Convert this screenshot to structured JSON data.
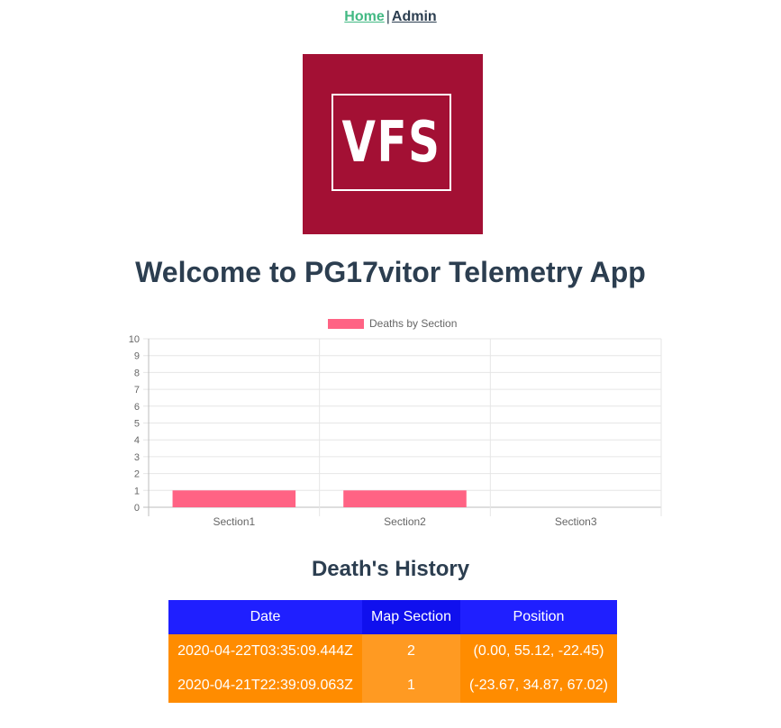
{
  "nav": {
    "home": "Home",
    "separator": "|",
    "admin": "Admin"
  },
  "logo": {
    "text": "VFS",
    "bg_color": "#a31034"
  },
  "title": "Welcome to PG17vitor Telemetry App",
  "chart_data": {
    "type": "bar",
    "categories": [
      "Section1",
      "Section2",
      "Section3"
    ],
    "series": [
      {
        "name": "Deaths by Section",
        "values": [
          1,
          1,
          0
        ],
        "color": "#ff6384"
      }
    ],
    "ylim": [
      0,
      10
    ],
    "yticks": [
      0,
      1,
      2,
      3,
      4,
      5,
      6,
      7,
      8,
      9,
      10
    ],
    "grid": true,
    "legend": "top"
  },
  "history": {
    "title": "Death's History",
    "columns": [
      "Date",
      "Map Section",
      "Position"
    ],
    "rows": [
      [
        "2020-04-22T03:35:09.444Z",
        "2",
        "(0.00, 55.12, -22.45)"
      ],
      [
        "2020-04-21T22:39:09.063Z",
        "1",
        "(-23.67, 34.87, 67.02)"
      ]
    ],
    "header_color": "#1f1fff",
    "row_color": "#ff8c00"
  }
}
